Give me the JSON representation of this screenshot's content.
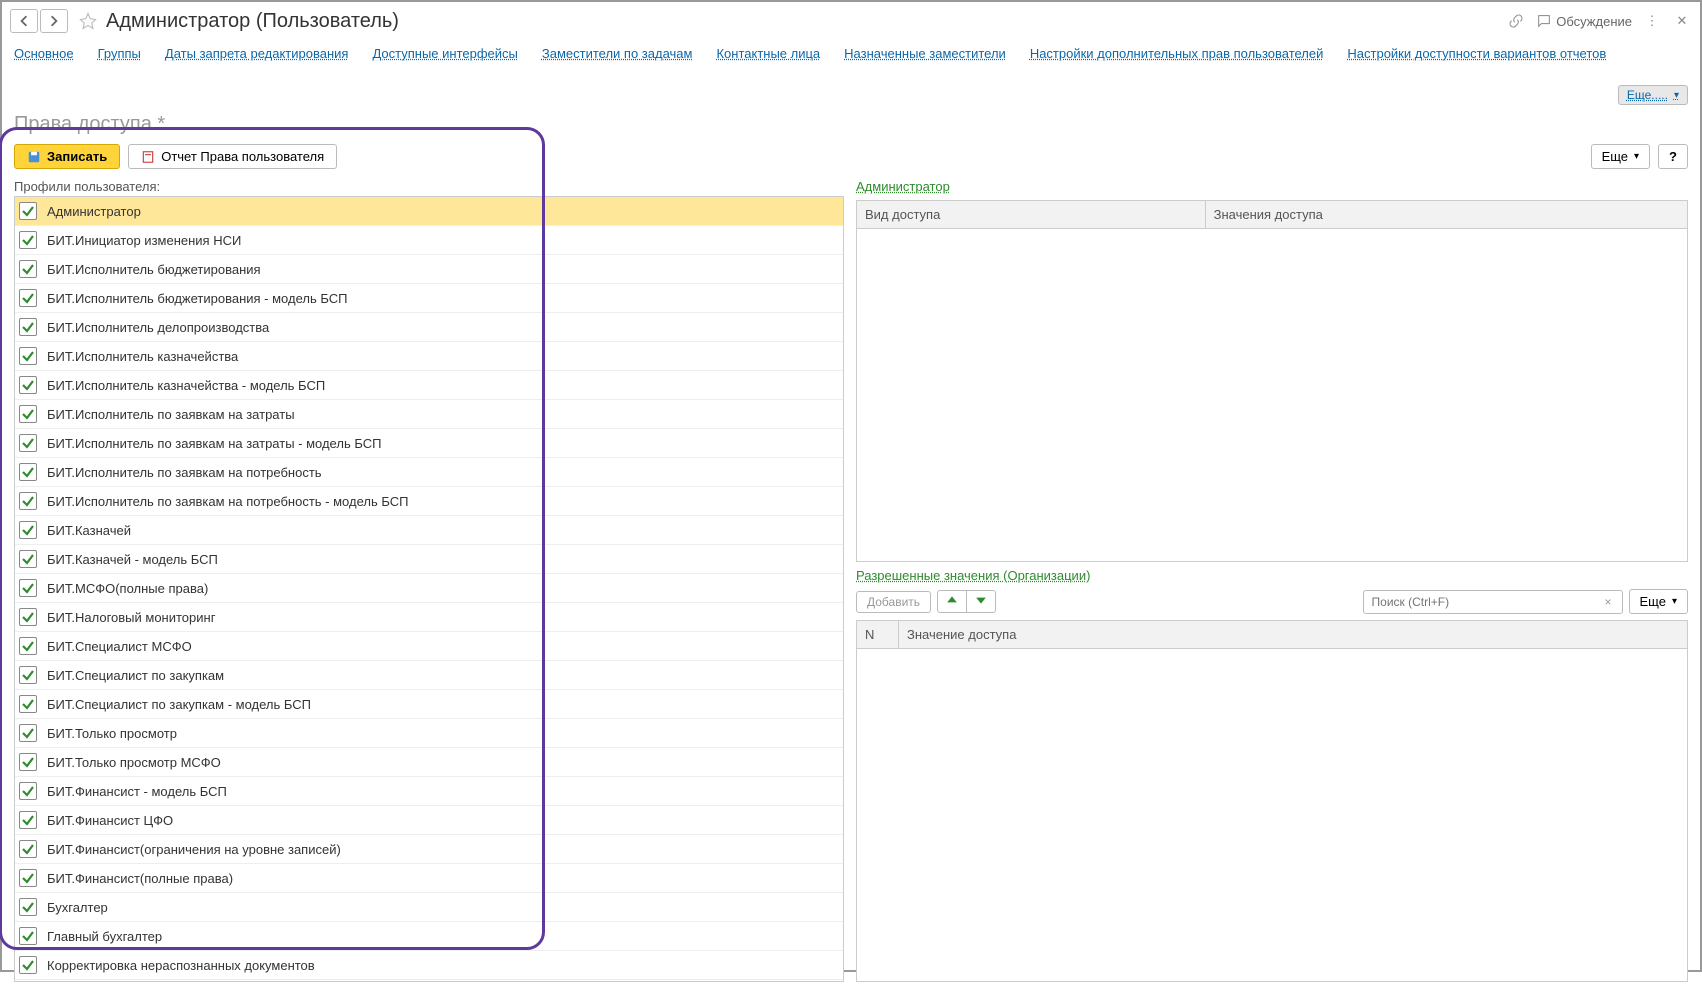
{
  "header": {
    "title": "Администратор (Пользователь)",
    "discussion": "Обсуждение"
  },
  "tabs": [
    "Основное",
    "Группы",
    "Даты запрета редактирования",
    "Доступные интерфейсы",
    "Заместители по задачам",
    "Контактные лица",
    "Назначенные заместители",
    "Настройки дополнительных прав пользователей",
    "Настройки доступности вариантов отчетов"
  ],
  "more_btn": "Еще.....",
  "subheading": "Права доступа *",
  "toolbar": {
    "save": "Записать",
    "report": "Отчет Права пользователя",
    "more": "Еще",
    "help": "?"
  },
  "left": {
    "label": "Профили пользователя:",
    "profiles": [
      {
        "checked": true,
        "label": "Администратор",
        "selected": true
      },
      {
        "checked": true,
        "label": "БИТ.Инициатор изменения НСИ"
      },
      {
        "checked": true,
        "label": "БИТ.Исполнитель бюджетирования"
      },
      {
        "checked": true,
        "label": "БИТ.Исполнитель бюджетирования - модель БСП"
      },
      {
        "checked": true,
        "label": "БИТ.Исполнитель делопроизводства"
      },
      {
        "checked": true,
        "label": "БИТ.Исполнитель казначейства"
      },
      {
        "checked": true,
        "label": "БИТ.Исполнитель казначейства - модель БСП"
      },
      {
        "checked": true,
        "label": "БИТ.Исполнитель по заявкам на затраты"
      },
      {
        "checked": true,
        "label": "БИТ.Исполнитель по заявкам на затраты - модель БСП"
      },
      {
        "checked": true,
        "label": "БИТ.Исполнитель по заявкам на потребность"
      },
      {
        "checked": true,
        "label": "БИТ.Исполнитель по заявкам на потребность - модель БСП"
      },
      {
        "checked": true,
        "label": "БИТ.Казначей"
      },
      {
        "checked": true,
        "label": "БИТ.Казначей - модель БСП"
      },
      {
        "checked": true,
        "label": "БИТ.МСФО(полные права)"
      },
      {
        "checked": true,
        "label": "БИТ.Налоговый мониторинг"
      },
      {
        "checked": true,
        "label": "БИТ.Специалист МСФО"
      },
      {
        "checked": true,
        "label": "БИТ.Специалист по закупкам"
      },
      {
        "checked": true,
        "label": "БИТ.Специалист по закупкам - модель БСП"
      },
      {
        "checked": true,
        "label": "БИТ.Только просмотр"
      },
      {
        "checked": true,
        "label": "БИТ.Только просмотр МСФО"
      },
      {
        "checked": true,
        "label": "БИТ.Финансист - модель БСП"
      },
      {
        "checked": true,
        "label": "БИТ.Финансист ЦФО"
      },
      {
        "checked": true,
        "label": "БИТ.Финансист(ограничения на уровне записей)"
      },
      {
        "checked": true,
        "label": "БИТ.Финансист(полные права)"
      },
      {
        "checked": true,
        "label": "Бухгалтер"
      },
      {
        "checked": true,
        "label": "Главный бухгалтер"
      },
      {
        "checked": true,
        "label": "Корректировка нераспознанных документов"
      }
    ]
  },
  "right": {
    "admin_label": "Администратор",
    "access_type": "Вид доступа",
    "access_values": "Значения доступа",
    "allowed_label": "Разрешенные значения (Организации)",
    "add": "Добавить",
    "search_placeholder": "Поиск (Ctrl+F)",
    "more": "Еще",
    "n_col": "N",
    "value_col": "Значение доступа"
  }
}
